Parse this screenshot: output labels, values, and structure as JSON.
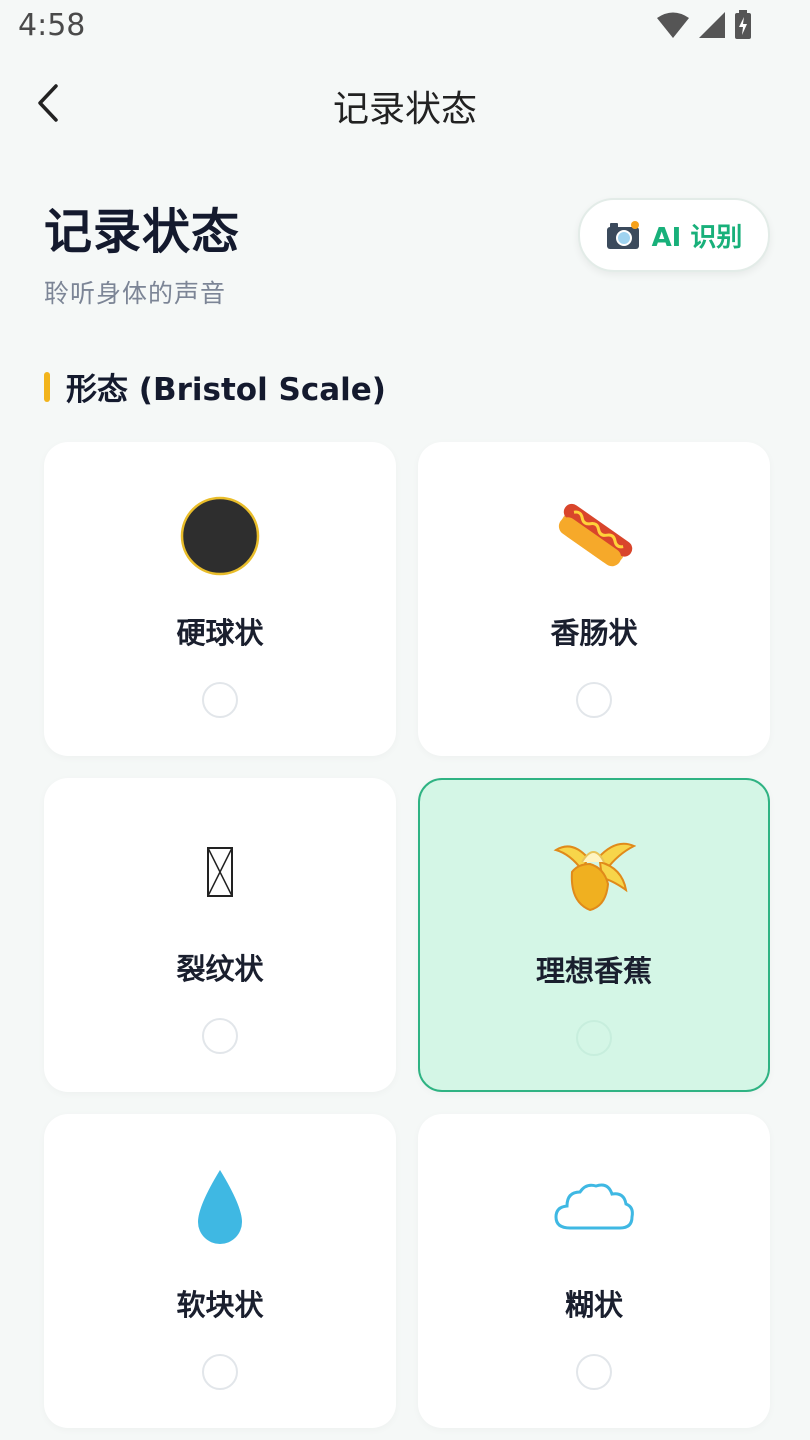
{
  "status_bar": {
    "time": "4:58"
  },
  "nav": {
    "title": "记录状态"
  },
  "header": {
    "title": "记录状态",
    "subtitle": "聆听身体的声音"
  },
  "ai_button": {
    "label": "AI 识别",
    "icon": "camera-icon"
  },
  "section": {
    "title": "形态 (Bristol Scale)"
  },
  "options": [
    {
      "label": "硬球状",
      "icon": "dark-ball-icon",
      "selected": false
    },
    {
      "label": "香肠状",
      "icon": "hotdog-icon",
      "selected": false
    },
    {
      "label": "裂纹状",
      "icon": "missing-glyph-icon",
      "selected": false
    },
    {
      "label": "理想香蕉",
      "icon": "banana-icon",
      "selected": true
    },
    {
      "label": "软块状",
      "icon": "droplet-icon",
      "selected": false
    },
    {
      "label": "糊状",
      "icon": "cloud-icon",
      "selected": false
    }
  ],
  "colors": {
    "accent": "#18b07a",
    "selected_bg": "#d4f6e6",
    "section_bar": "#f2b41c"
  }
}
